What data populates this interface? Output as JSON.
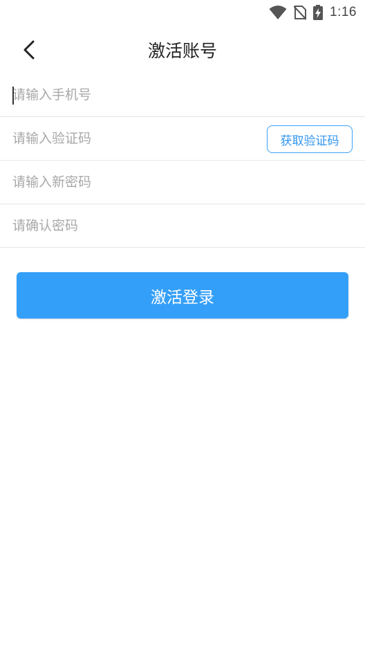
{
  "status_bar": {
    "time": "1:16",
    "icons": [
      "wifi-icon",
      "no-sim-icon",
      "battery-charging-icon"
    ]
  },
  "header": {
    "back_icon": "chevron-left-icon",
    "title": "激活账号"
  },
  "form": {
    "phone_placeholder": "请输入手机号",
    "code_placeholder": "请输入验证码",
    "get_code_label": "获取验证码",
    "new_password_placeholder": "请输入新密码",
    "confirm_password_placeholder": "请确认密码"
  },
  "submit_label": "激活登录",
  "colors": {
    "accent": "#349ff8",
    "divider": "#e6e6e6",
    "placeholder": "#a8a8a8"
  }
}
